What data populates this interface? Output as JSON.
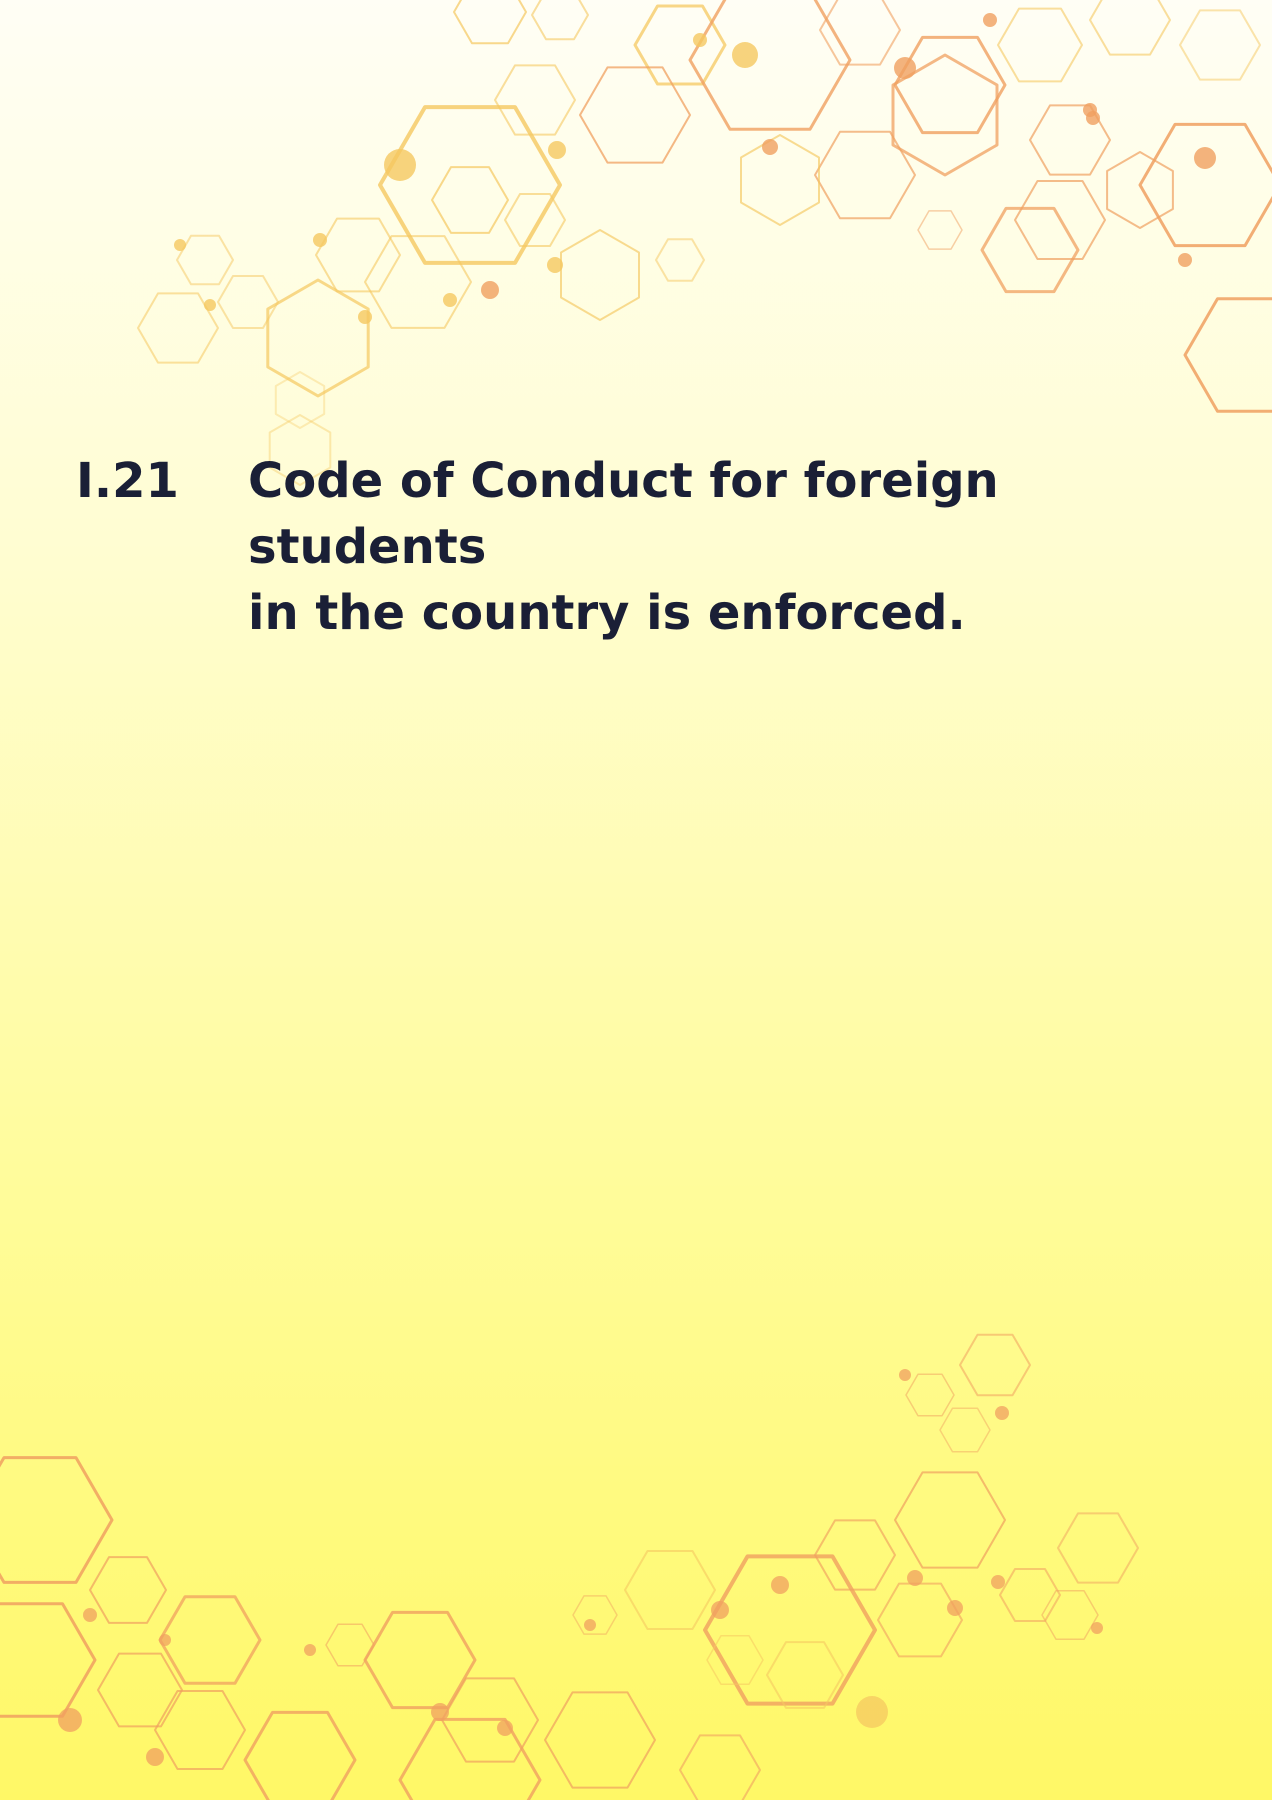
{
  "section": {
    "number": "I.21",
    "line1": "Code of Conduct for foreign students",
    "line2": "in the country is enforced."
  },
  "colors": {
    "text": "#1a1f36",
    "hex_orange": "#f0a060",
    "hex_gold": "#f5c860",
    "bg_top": "#fffef5",
    "bg_bottom": "#fff866"
  },
  "decoration": {
    "top_right": "hexagon-network-top",
    "bottom_left": "hexagon-network-bottom"
  }
}
